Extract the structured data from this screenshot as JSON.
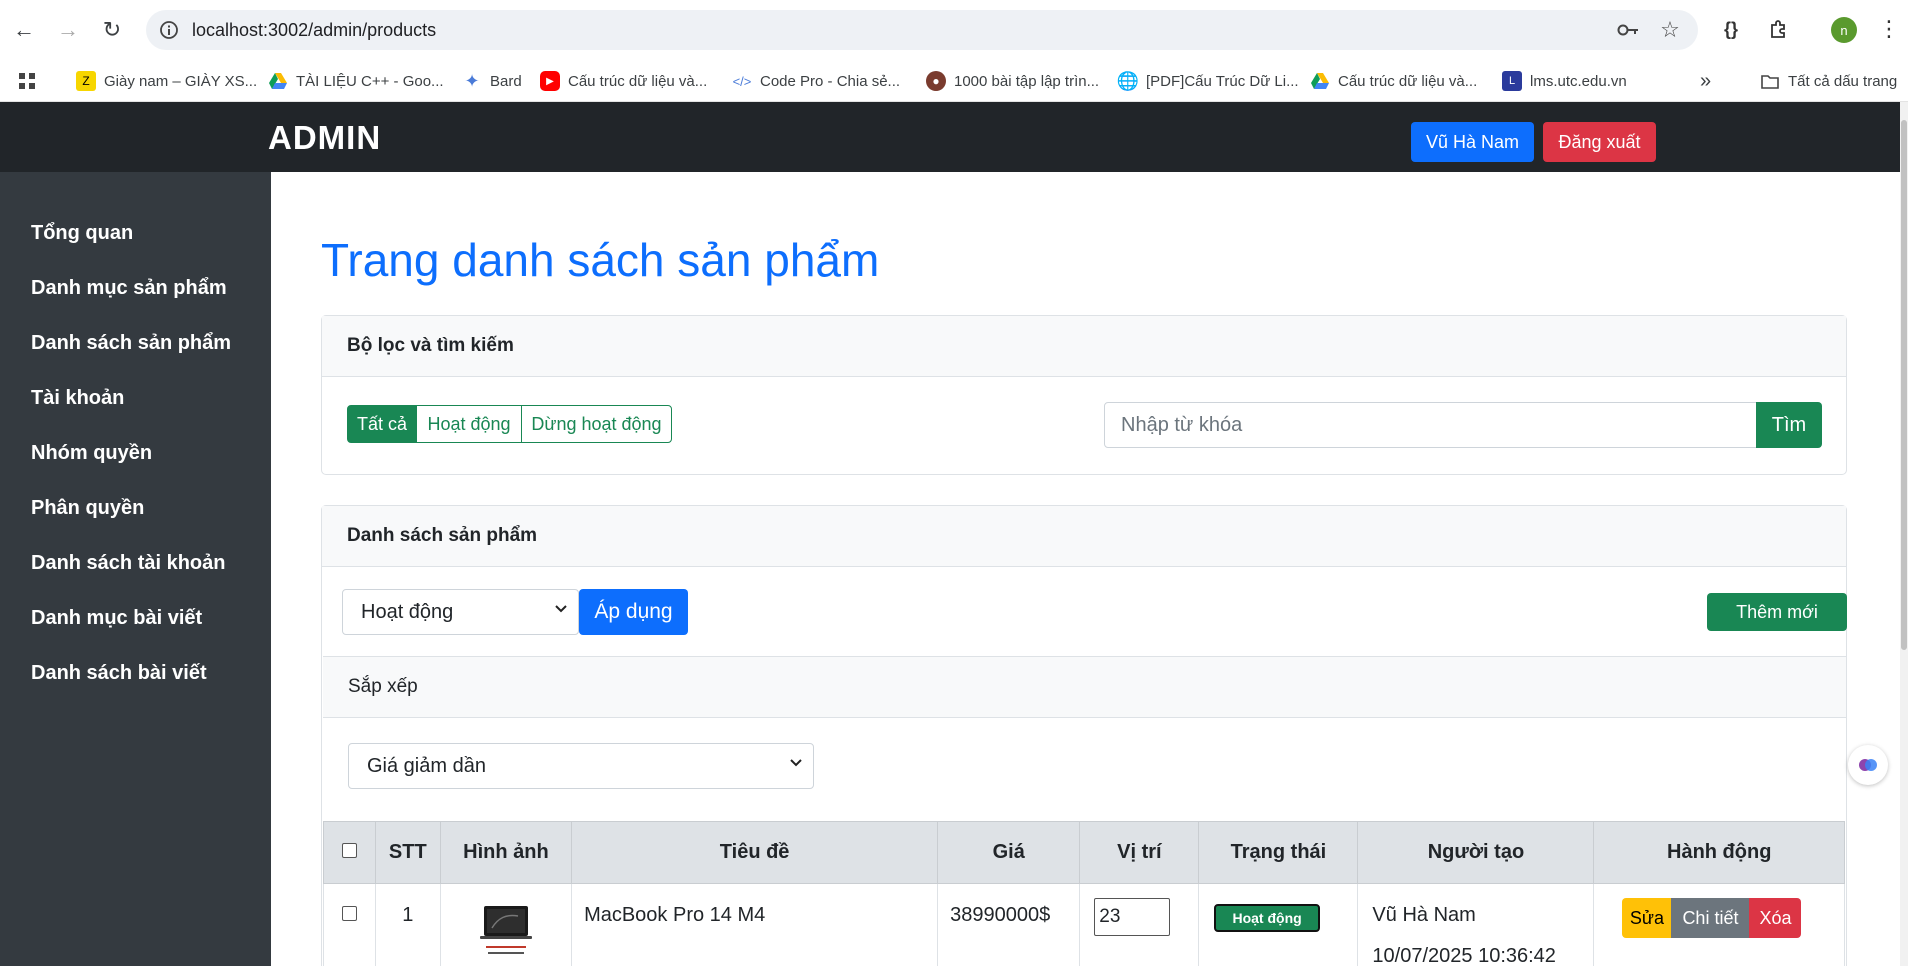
{
  "browser": {
    "url": "localhost:3002/admin/products",
    "profile_initial": "n",
    "bookmarks": [
      "Giày nam – GIÀY XS...",
      "TÀI LIỆU C++ - Goo...",
      "Bard",
      "Cấu trúc dữ liệu và...",
      "Code Pro - Chia sẻ...",
      "1000 bài tập lập trìn...",
      "[PDF]Cấu Trúc Dữ Li...",
      "Cấu trúc dữ liệu và...",
      "lms.utc.edu.vn"
    ],
    "all_bookmarks": "Tất cả dấu trang"
  },
  "header": {
    "brand": "ADMIN",
    "user_label": "Vũ Hà Nam",
    "logout_label": "Đăng xuất"
  },
  "sidebar": {
    "items": [
      "Tổng quan",
      "Danh mục sản phẩm",
      "Danh sách sản phẩm",
      "Tài khoản",
      "Nhóm quyền",
      "Phân quyền",
      "Danh sách tài khoản",
      "Danh mục bài viết",
      "Danh sách bài viết"
    ]
  },
  "main": {
    "title": "Trang danh sách sản phẩm",
    "filter": {
      "heading": "Bộ lọc và tìm kiếm",
      "buttons": [
        "Tất cả",
        "Hoạt động",
        "Dừng hoạt động"
      ],
      "search_placeholder": "Nhập từ khóa",
      "search_button": "Tìm"
    },
    "list": {
      "heading": "Danh sách sản phẩm",
      "bulk_select": "Hoạt động",
      "apply_button": "Áp dụng",
      "add_button": "Thêm mới",
      "sort": {
        "heading": "Sắp xếp",
        "selected": "Giá giảm dần"
      },
      "columns": [
        "STT",
        "Hình ảnh",
        "Tiêu đề",
        "Giá",
        "Vị trí",
        "Trạng thái",
        "Người tạo",
        "Hành động"
      ],
      "rows": [
        {
          "index": "1",
          "title": "MacBook Pro 14 M4",
          "price": "38990000$",
          "position": "23",
          "status": "Hoạt động",
          "creator": "Vũ Hà Nam",
          "created_at": "10/07/2025 10:36:42"
        }
      ],
      "actions": [
        "Sửa",
        "Chi tiết",
        "Xóa"
      ]
    }
  },
  "colors": {
    "primary": "#0d6efd",
    "success": "#198754",
    "danger": "#dc3545",
    "warning": "#ffc107",
    "secondary": "#6c757d",
    "dark": "#212529",
    "sidebar": "#343a40"
  }
}
